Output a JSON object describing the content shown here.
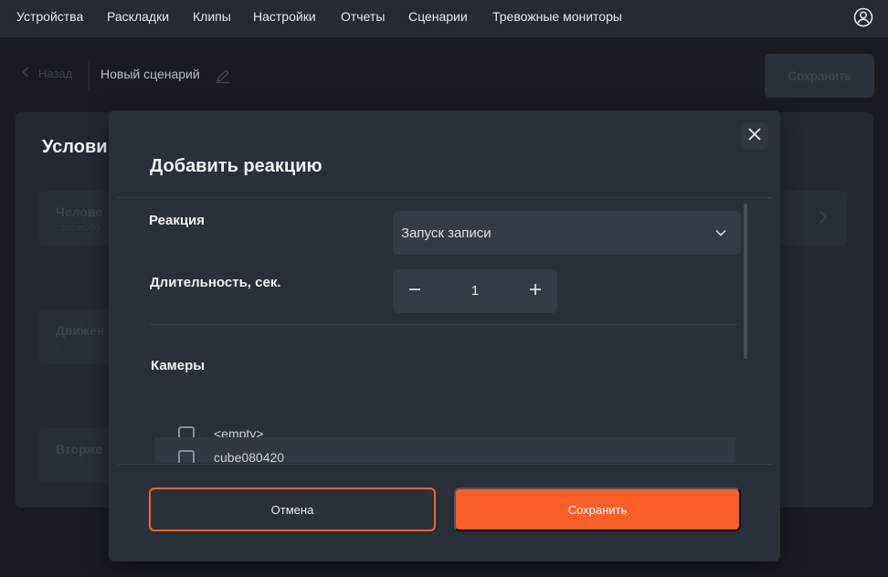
{
  "nav": {
    "items": [
      "Устройства",
      "Раскладки",
      "Клипы",
      "Настройки",
      "Отчеты",
      "Сценарии",
      "Тревожные мониторы"
    ]
  },
  "page": {
    "back_label": "Назад",
    "scenario_title": "Новый сценарий",
    "save_label": "Сохранить",
    "conditions_heading": "Услови",
    "cards": [
      {
        "title": "Челове",
        "subtitle": ": cube080"
      },
      {
        "title": "Движен",
        "subtitle": ":"
      },
      {
        "title": "Вторже",
        "subtitle": ":"
      }
    ]
  },
  "modal": {
    "title": "Добавить реакцию",
    "reaction_label": "Реакция",
    "reaction_value": "Запуск записи",
    "duration_label": "Длительность, сек.",
    "duration_value": "1",
    "cameras_label": "Камеры",
    "cameras": [
      "<empty>",
      "cube080420"
    ],
    "cancel_label": "Отмена",
    "save_label": "Сохранить"
  },
  "colors": {
    "accent": "#fa5f2a",
    "nav_bg": "#252a33",
    "page_bg": "#181c22",
    "modal_bg": "#2a3039"
  }
}
